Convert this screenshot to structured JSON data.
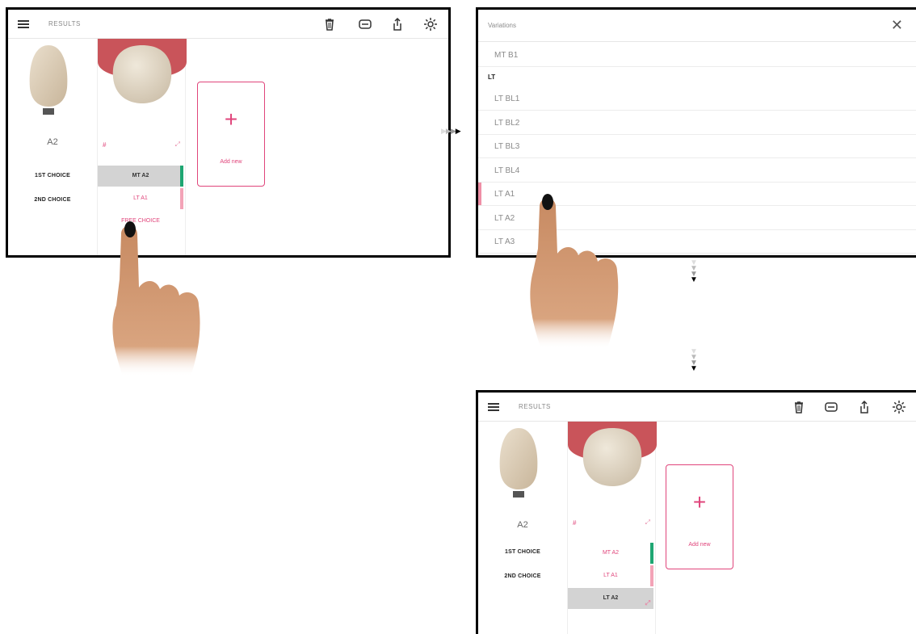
{
  "screen_before": {
    "topbar": {
      "title": "RESULTS",
      "icons": [
        "menu-icon",
        "trash-icon",
        "print-icon",
        "share-icon",
        "settings-icon"
      ]
    },
    "shade": {
      "name": "A2"
    },
    "choices": {
      "first": "1ST CHOICE",
      "second": "2ND CHOICE"
    },
    "result": {
      "hash": "#",
      "rows": [
        {
          "label": "MT A2",
          "state": "selected",
          "bar_color": "#1ea672"
        },
        {
          "label": "LT A1",
          "state": "normal",
          "bar_color": "#f3a3b7"
        },
        {
          "label": "FREE CHOICE",
          "state": "normal"
        }
      ]
    },
    "add_card": {
      "label": "Add new"
    }
  },
  "variations": {
    "title": "Variations",
    "items_before": [
      "MT B1"
    ],
    "section": "LT",
    "items": [
      "LT BL1",
      "LT BL2",
      "LT BL3",
      "LT BL4",
      "LT A1",
      "LT A2",
      "LT A3"
    ],
    "marked_item": "LT A1"
  },
  "screen_after": {
    "topbar": {
      "title": "RESULTS"
    },
    "shade": {
      "name": "A2"
    },
    "choices": {
      "first": "1ST CHOICE",
      "second": "2ND CHOICE"
    },
    "result": {
      "hash": "#",
      "rows": [
        {
          "label": "MT A2",
          "state": "normal",
          "bar_color": "#1ea672"
        },
        {
          "label": "LT A1",
          "state": "normal",
          "bar_color": "#f3a3b7"
        },
        {
          "label": "LT A2",
          "state": "selected"
        }
      ]
    },
    "add_card": {
      "label": "Add new"
    }
  },
  "colors": {
    "accent": "#e0457b",
    "green": "#1ea672",
    "pink_bar": "#f3a3b7",
    "gum": "#c9545a"
  }
}
